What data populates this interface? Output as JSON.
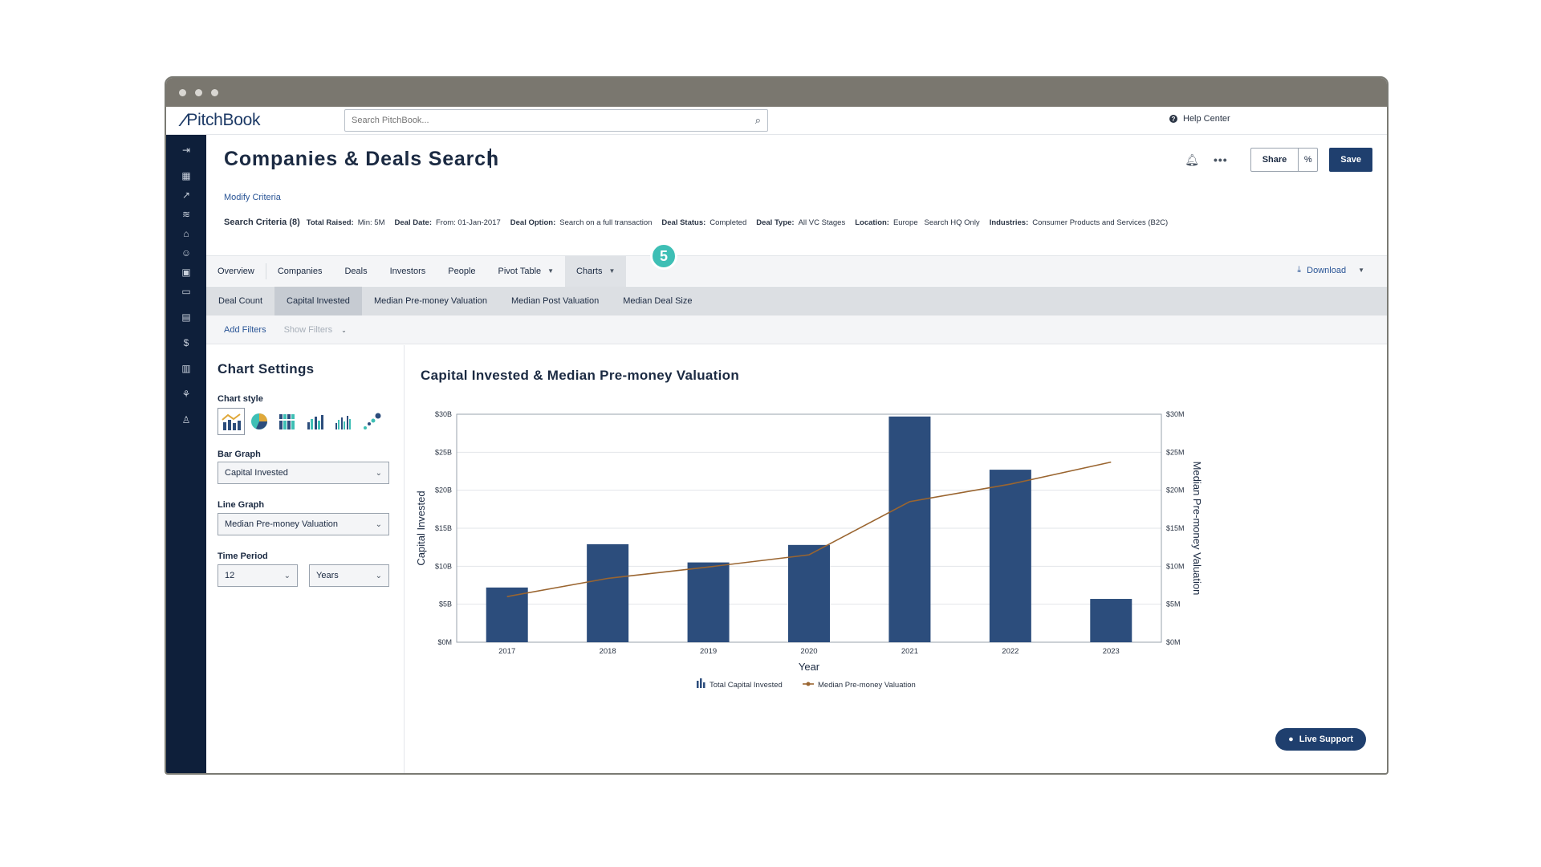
{
  "app": {
    "logo": "PitchBook"
  },
  "search": {
    "placeholder": "Search PitchBook..."
  },
  "help": {
    "label": "Help Center"
  },
  "page": {
    "title": "Companies & Deals Search",
    "modify": "Modify Criteria",
    "criteria_head": "Search Criteria (8)",
    "criteria": [
      {
        "k": "Total Raised:",
        "v": "Min: 5M"
      },
      {
        "k": "Deal Date:",
        "v": "From: 01-Jan-2017"
      },
      {
        "k": "Deal Option:",
        "v": "Search on a full transaction"
      },
      {
        "k": "Deal Status:",
        "v": "Completed"
      },
      {
        "k": "Deal Type:",
        "v": "All VC Stages"
      },
      {
        "k": "Location:",
        "v": "Europe   Search HQ Only"
      },
      {
        "k": "Industries:",
        "v": "Consumer Products and Services (B2C)"
      }
    ]
  },
  "actions": {
    "share": "Share",
    "save": "Save"
  },
  "tabs": [
    "Overview",
    "Companies",
    "Deals",
    "Investors",
    "People",
    "Pivot Table",
    "Charts"
  ],
  "badge": "5",
  "download": "Download",
  "subtabs": [
    "Deal Count",
    "Capital Invested",
    "Median Pre-money Valuation",
    "Median Post Valuation",
    "Median Deal Size"
  ],
  "filters": {
    "add": "Add Filters",
    "show": "Show Filters"
  },
  "settings": {
    "title": "Chart Settings",
    "style_label": "Chart style",
    "bar_label": "Bar Graph",
    "bar_value": "Capital Invested",
    "line_label": "Line Graph",
    "line_value": "Median Pre-money Valuation",
    "period_label": "Time Period",
    "period_value": "12",
    "period_unit": "Years"
  },
  "live_support": "Live Support",
  "chart_data": {
    "type": "bar",
    "title": "Capital Invested & Median Pre-money Valuation",
    "xlabel": "Year",
    "ylabel": "Capital Invested",
    "y2label": "Median Pre-money Valuation",
    "categories": [
      "2017",
      "2018",
      "2019",
      "2020",
      "2021",
      "2022",
      "2023"
    ],
    "ylim": [
      0,
      30
    ],
    "y2lim": [
      0,
      30
    ],
    "yticks": [
      "$0M",
      "$5B",
      "$10B",
      "$15B",
      "$20B",
      "$25B",
      "$30B"
    ],
    "y2ticks": [
      "$0M",
      "$5M",
      "$10M",
      "$15M",
      "$20M",
      "$25M",
      "$30M"
    ],
    "series": [
      {
        "name": "Total Capital Invested",
        "type": "bar",
        "values": [
          7.2,
          12.9,
          10.5,
          12.8,
          29.7,
          22.7,
          5.7
        ],
        "color": "#2c4d7c"
      },
      {
        "name": "Median Pre-money Valuation",
        "type": "line",
        "values": [
          6.0,
          8.4,
          9.9,
          11.5,
          18.5,
          20.8,
          23.7
        ],
        "color": "#9a6530"
      }
    ],
    "grid": true,
    "legend": "bottom"
  }
}
